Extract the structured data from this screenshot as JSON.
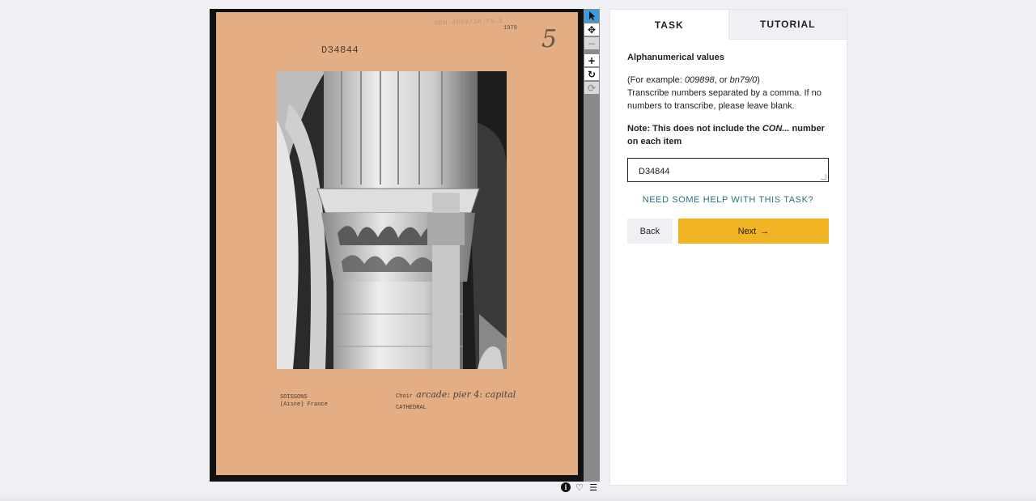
{
  "subject": {
    "stamp_top": "GEN-4000/1H.F5.5",
    "stamp_year": "1979",
    "ref_number": "D34844",
    "handwritten_number": "5",
    "caption_left_line1": "SOISSONS",
    "caption_left_line2": "(Aisne) France",
    "caption_right_prefix": "Choir",
    "caption_right_handwritten": "arcade: pier 4: capital",
    "caption_right_line2": "CATHEDRAL"
  },
  "toolbar": {
    "icons": [
      "pointer-icon",
      "move-icon",
      "zoom-out-icon",
      "zoom-in-icon",
      "rotate-icon",
      "reset-icon"
    ]
  },
  "meta": {
    "icons": [
      "info-icon",
      "heart-icon",
      "list-icon"
    ]
  },
  "tabs": [
    {
      "label": "TASK",
      "active": true
    },
    {
      "label": "TUTORIAL",
      "active": false
    }
  ],
  "task": {
    "title": "Alphanumerical values",
    "example_prefix": "(For example: ",
    "example_1": "009898",
    "example_sep": ", or ",
    "example_2": "bn79/0",
    "example_suffix": ")",
    "instruction": "Transcribe numbers separated by a comma. If no numbers to transcribe, please leave blank.",
    "note_prefix": "Note: This does not include the ",
    "note_em": "CON...",
    "note_suffix": " number on each item",
    "input_value": "D34844",
    "help_link": "NEED SOME HELP WITH THIS TASK?",
    "back_label": "Back",
    "next_label": "Next",
    "next_arrow": "→"
  },
  "colors": {
    "accent": "#f0b323",
    "link": "#2a6f7f",
    "card": "#e3ae84",
    "tool_active": "#3c9bdb"
  }
}
